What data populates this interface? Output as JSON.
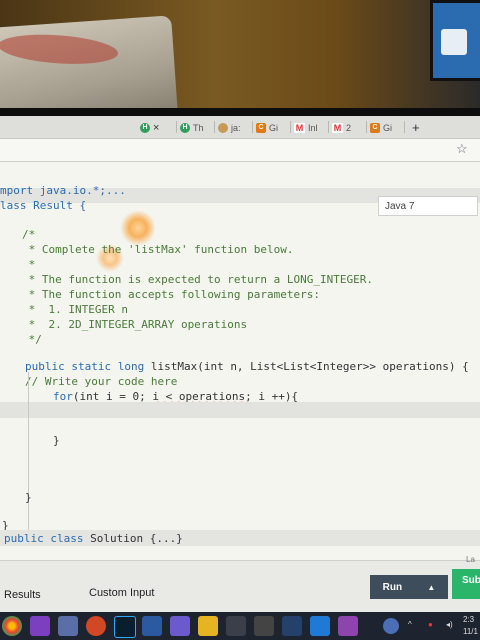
{
  "browser": {
    "tabs": [
      {
        "label": "Th"
      },
      {
        "label": "ja:"
      },
      {
        "label": "Gi"
      },
      {
        "label": "Inl"
      },
      {
        "label": "2"
      },
      {
        "label": "Gi"
      }
    ],
    "close_glyph": "×",
    "new_tab": "+"
  },
  "editor": {
    "language": "Java 7",
    "lines": {
      "l1": "mport java.io.*;...",
      "l2": "lass Result {",
      "l3": "/*",
      "l4": " * Complete the 'listMax' function below.",
      "l5": " *",
      "l6": " * The function is expected to return a LONG_INTEGER.",
      "l7": " * The function accepts following parameters:",
      "l8": " *  1. INTEGER n",
      "l9": " *  2. 2D_INTEGER_ARRAY operations",
      "l10": " */",
      "l11a": "public static long ",
      "l11b": "listMax(int n, List<List<Integer>> operations) {",
      "l12": "// Write your code here",
      "l13a": "for",
      "l13b": "(int i = 0; ",
      "l13c": "i < operations",
      "l13d": "; i ++){",
      "l14": "}",
      "l15": "}",
      "l16": "}",
      "l17a": "public class ",
      "l17b": "Solution {...}"
    }
  },
  "bottom": {
    "results": "Results",
    "custom_input": "Custom Input",
    "run": "Run",
    "run_caret": "▲",
    "submit": "Sub",
    "la": "La"
  },
  "taskbar": {
    "time": "2:3",
    "date": "11/1"
  },
  "colors": {
    "run_button": "#3d4d5c",
    "submit_button": "#2bb56b",
    "keyword": "#2a6cb0",
    "comment": "#4a7a3a"
  }
}
